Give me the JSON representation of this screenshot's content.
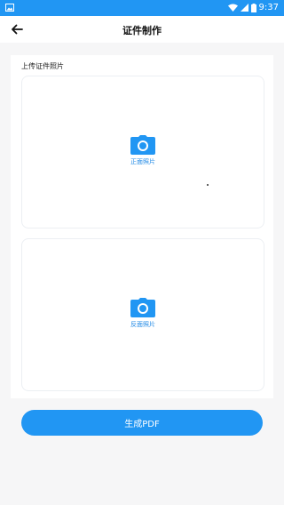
{
  "status_bar": {
    "time": "9:37",
    "icons": [
      "image-icon",
      "wifi-icon",
      "signal-icon",
      "battery-icon"
    ],
    "color": "#2196f3"
  },
  "header": {
    "title": "证件制作"
  },
  "upload": {
    "section_label": "上传证件照片",
    "front_label": "正面照片",
    "back_label": "反面照片"
  },
  "actions": {
    "generate_label": "生成PDF"
  },
  "colors": {
    "accent": "#2196f3",
    "link_text": "#1e88e5",
    "background": "#f6f6f7"
  }
}
